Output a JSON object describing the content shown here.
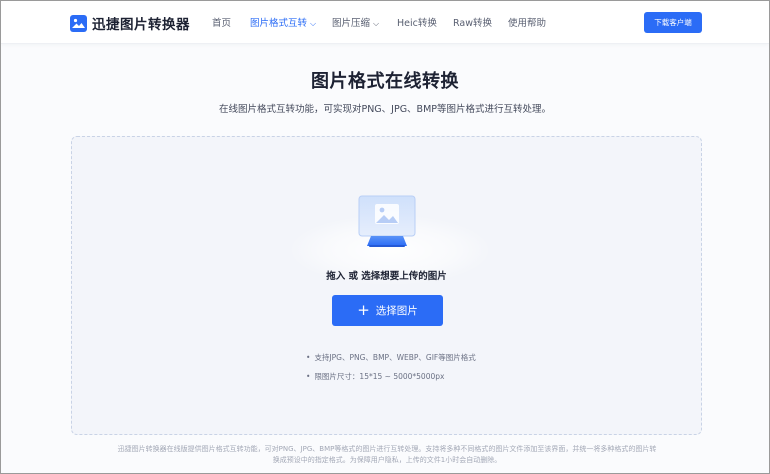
{
  "header": {
    "logo_text": "迅捷图片转换器",
    "nav": [
      {
        "label": "首页",
        "active": false,
        "dropdown": false
      },
      {
        "label": "图片格式互转",
        "active": true,
        "dropdown": true
      },
      {
        "label": "图片压缩",
        "active": false,
        "dropdown": true
      },
      {
        "label": "Heic转换",
        "active": false,
        "dropdown": false
      },
      {
        "label": "Raw转换",
        "active": false,
        "dropdown": false
      },
      {
        "label": "使用帮助",
        "active": false,
        "dropdown": false
      }
    ],
    "download_label": "下载客户端"
  },
  "main": {
    "title": "图片格式在线转换",
    "subtitle": "在线图片格式互转功能，可实现对PNG、JPG、BMP等图片格式进行互转处理。"
  },
  "upload": {
    "illustration_icon": "image-upload-icon",
    "drop_text": "拖入 或 选择想要上传的图片",
    "button_icon": "plus-icon",
    "button_label": "选择图片",
    "tips": [
      "支持JPG、PNG、BMP、WEBP、GIF等图片格式",
      "限图片尺寸：15*15 ~ 5000*5000px"
    ]
  },
  "footer": {
    "line1": "迅捷图片转换器在线版提供图片格式互转功能，可对PNG、JPG、BMP等格式的图片进行互转处理。支持将多种不同格式的图片文件添加至该界面，并统一将多种格式的图片转",
    "line2": "换成预设中的指定格式。为保障用户隐私，上传的文件1小时会自动删除。"
  },
  "colors": {
    "accent": "#2b6cf6",
    "title": "#1d2233",
    "upload_bg": "#f3f5fa",
    "upload_border": "#c9d3e6"
  }
}
